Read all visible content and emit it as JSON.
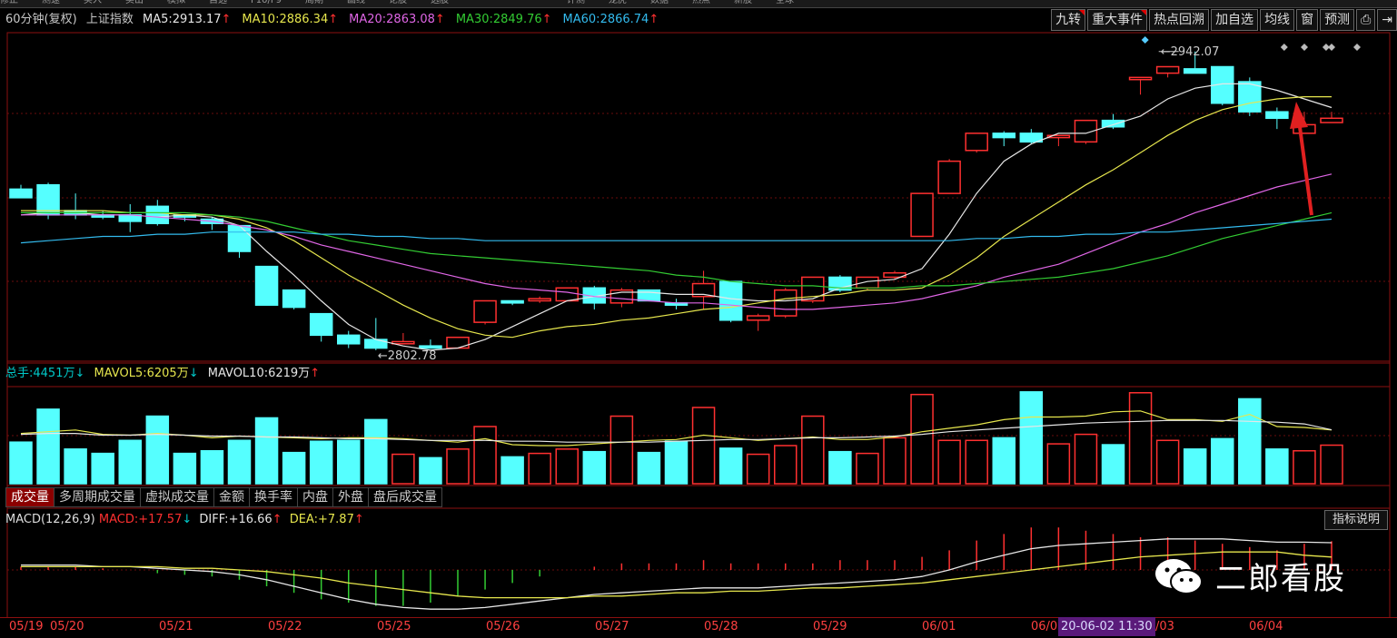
{
  "top_menu": [
    "修正",
    "测速",
    "买入",
    "卖出",
    "模拟",
    "自选",
    "F10/F9",
    "周期",
    "画线",
    "论股",
    "选股",
    "",
    "",
    "",
    "",
    "评测",
    "龙虎",
    "数据",
    "热点",
    "新股",
    "全球",
    "",
    "",
    ""
  ],
  "header": {
    "period": "60分钟(复权)",
    "index_name": "上证指数",
    "ma": [
      {
        "label": "MA5:",
        "value": "2913.17",
        "arrow": "↑",
        "color": "#e6e6e6"
      },
      {
        "label": "MA10:",
        "value": "2886.34",
        "arrow": "↑",
        "color": "#e6e64d"
      },
      {
        "label": "MA20:",
        "value": "2863.08",
        "arrow": "↑",
        "color": "#e066e6"
      },
      {
        "label": "MA30:",
        "value": "2849.76",
        "arrow": "↑",
        "color": "#33cc33"
      },
      {
        "label": "MA60:",
        "value": "2866.74",
        "arrow": "↑",
        "color": "#33bbee"
      }
    ]
  },
  "right_buttons": [
    {
      "label": "九转",
      "flag": true
    },
    {
      "label": "重大事件",
      "flag": true
    },
    {
      "label": "热点回溯",
      "flag": false
    },
    {
      "label": "加自选",
      "flag": false
    },
    {
      "label": "均线",
      "flag": false
    },
    {
      "label": "窗",
      "flag": false
    },
    {
      "label": "预测",
      "flag": false
    },
    {
      "label": "⎙",
      "flag": false
    },
    {
      "label": "⇥",
      "flag": false
    }
  ],
  "price_annotations": {
    "high": "2942.07",
    "low": "2802.78"
  },
  "volume_header": {
    "total_label": "总手:",
    "total_value": "4451万",
    "total_arrow": "↓",
    "mavol5_label": "MAVOL5:",
    "mavol5_value": "6205万",
    "mavol5_arrow": "↓",
    "mavol10_label": "MAVOL10:",
    "mavol10_value": "6219万",
    "mavol10_arrow": "↑"
  },
  "tabs": [
    "成交量",
    "多周期成交量",
    "虚拟成交量",
    "金额",
    "换手率",
    "内盘",
    "外盘",
    "盘后成交量"
  ],
  "macd_header": {
    "name": "MACD(12,26,9)",
    "macd_label": "MACD:",
    "macd_value": "+17.57",
    "macd_arrow": "↓",
    "diff_label": "DIFF:",
    "diff_value": "+16.66",
    "diff_arrow": "↑",
    "dea_label": "DEA:",
    "dea_value": "+7.87",
    "dea_arrow": "↑"
  },
  "macd_help": "指标说明",
  "watermark": "二郎看股",
  "dates": [
    "05/19",
    "05/20",
    "05/21",
    "05/22",
    "05/25",
    "05/26",
    "05/27",
    "05/28",
    "05/29",
    "06/01",
    "06/0",
    "/03",
    "06/04"
  ],
  "cursor_label": "20-06-02 11:30",
  "colors": {
    "up": "#ff3030",
    "down": "#55ffff",
    "ma5": "#e6e6e6",
    "ma10": "#e6e64d",
    "ma20": "#e066e6",
    "ma30": "#33cc33",
    "ma60": "#33bbee"
  },
  "chart_data": {
    "type": "candlestick",
    "interval": "60min",
    "price_range": [
      2800,
      2950
    ],
    "candles": [
      {
        "o": 2878,
        "h": 2880,
        "l": 2874,
        "c": 2874
      },
      {
        "o": 2880,
        "h": 2881,
        "l": 2864,
        "c": 2866
      },
      {
        "o": 2868,
        "h": 2876,
        "l": 2864,
        "c": 2866
      },
      {
        "o": 2866,
        "h": 2868,
        "l": 2864,
        "c": 2865
      },
      {
        "o": 2866,
        "h": 2871,
        "l": 2858,
        "c": 2863
      },
      {
        "o": 2870,
        "h": 2873,
        "l": 2861,
        "c": 2862
      },
      {
        "o": 2866,
        "h": 2866,
        "l": 2863,
        "c": 2865
      },
      {
        "o": 2864,
        "h": 2865,
        "l": 2859,
        "c": 2862
      },
      {
        "o": 2861,
        "h": 2861,
        "l": 2846,
        "c": 2849
      },
      {
        "o": 2842,
        "h": 2842,
        "l": 2824,
        "c": 2824
      },
      {
        "o": 2831,
        "h": 2831,
        "l": 2822,
        "c": 2823
      },
      {
        "o": 2820,
        "h": 2820,
        "l": 2807,
        "c": 2810
      },
      {
        "o": 2810,
        "h": 2812,
        "l": 2804,
        "c": 2806
      },
      {
        "o": 2808,
        "h": 2818,
        "l": 2803,
        "c": 2804
      },
      {
        "o": 2806,
        "h": 2811,
        "l": 2806,
        "c": 2807
      },
      {
        "o": 2805,
        "h": 2808,
        "l": 2804,
        "c": 2804
      },
      {
        "o": 2804,
        "h": 2809,
        "l": 2804,
        "c": 2809
      },
      {
        "o": 2816,
        "h": 2826,
        "l": 2815,
        "c": 2826
      },
      {
        "o": 2826,
        "h": 2826,
        "l": 2824,
        "c": 2825
      },
      {
        "o": 2826,
        "h": 2828,
        "l": 2825,
        "c": 2827
      },
      {
        "o": 2826,
        "h": 2832,
        "l": 2826,
        "c": 2832
      },
      {
        "o": 2832,
        "h": 2833,
        "l": 2822,
        "c": 2825
      },
      {
        "o": 2825,
        "h": 2832,
        "l": 2823,
        "c": 2831
      },
      {
        "o": 2831,
        "h": 2831,
        "l": 2826,
        "c": 2826
      },
      {
        "o": 2825,
        "h": 2827,
        "l": 2822,
        "c": 2824
      },
      {
        "o": 2828,
        "h": 2840,
        "l": 2822,
        "c": 2834
      },
      {
        "o": 2835,
        "h": 2835,
        "l": 2816,
        "c": 2817
      },
      {
        "o": 2817,
        "h": 2820,
        "l": 2812,
        "c": 2819
      },
      {
        "o": 2819,
        "h": 2832,
        "l": 2818,
        "c": 2831
      },
      {
        "o": 2826,
        "h": 2837,
        "l": 2825,
        "c": 2837
      },
      {
        "o": 2837,
        "h": 2838,
        "l": 2830,
        "c": 2831
      },
      {
        "o": 2832,
        "h": 2837,
        "l": 2831,
        "c": 2837
      },
      {
        "o": 2837,
        "h": 2840,
        "l": 2836,
        "c": 2839
      },
      {
        "o": 2856,
        "h": 2876,
        "l": 2856,
        "c": 2876
      },
      {
        "o": 2876,
        "h": 2892,
        "l": 2876,
        "c": 2891
      },
      {
        "o": 2896,
        "h": 2904,
        "l": 2895,
        "c": 2904
      },
      {
        "o": 2904,
        "h": 2905,
        "l": 2898,
        "c": 2902
      },
      {
        "o": 2904,
        "h": 2906,
        "l": 2899,
        "c": 2900
      },
      {
        "o": 2902,
        "h": 2903,
        "l": 2898,
        "c": 2903
      },
      {
        "o": 2900,
        "h": 2910,
        "l": 2899,
        "c": 2910
      },
      {
        "o": 2910,
        "h": 2913,
        "l": 2906,
        "c": 2907
      },
      {
        "o": 2929,
        "h": 2930,
        "l": 2922,
        "c": 2930
      },
      {
        "o": 2932,
        "h": 2935,
        "l": 2930,
        "c": 2935
      },
      {
        "o": 2934,
        "h": 2942.07,
        "l": 2932,
        "c": 2932
      },
      {
        "o": 2935,
        "h": 2935,
        "l": 2917,
        "c": 2918
      },
      {
        "o": 2928,
        "h": 2930,
        "l": 2912,
        "c": 2914
      },
      {
        "o": 2914,
        "h": 2916,
        "l": 2906,
        "c": 2911
      },
      {
        "o": 2904,
        "h": 2914,
        "l": 2904,
        "c": 2908
      },
      {
        "o": 2909,
        "h": 2914,
        "l": 2909,
        "c": 2911
      }
    ],
    "ma_lines": {
      "MA5": [
        2866,
        2867,
        2867,
        2866,
        2866,
        2865,
        2866,
        2865,
        2861,
        2849,
        2838,
        2826,
        2815,
        2808,
        2805,
        2803,
        2804,
        2808,
        2814,
        2820,
        2826,
        2828,
        2830,
        2830,
        2829,
        2829,
        2827,
        2826,
        2826,
        2827,
        2832,
        2835,
        2836,
        2841,
        2857,
        2876,
        2891,
        2899,
        2904,
        2904,
        2908,
        2912,
        2920,
        2925,
        2927,
        2927,
        2924,
        2920,
        2916
      ],
      "MA10": [
        2868,
        2868,
        2868,
        2868,
        2867,
        2867,
        2866,
        2866,
        2864,
        2860,
        2854,
        2846,
        2838,
        2831,
        2824,
        2818,
        2813,
        2810,
        2809,
        2812,
        2814,
        2815,
        2817,
        2818,
        2820,
        2822,
        2823,
        2825,
        2827,
        2828,
        2829,
        2831,
        2831,
        2832,
        2838,
        2846,
        2856,
        2864,
        2872,
        2880,
        2887,
        2895,
        2903,
        2910,
        2915,
        2918,
        2920,
        2921,
        2921
      ],
      "MA20": [
        2866,
        2866,
        2866,
        2866,
        2866,
        2865,
        2864,
        2863,
        2861,
        2859,
        2856,
        2852,
        2849,
        2846,
        2843,
        2840,
        2837,
        2834,
        2832,
        2831,
        2830,
        2828,
        2827,
        2826,
        2825,
        2825,
        2824,
        2823,
        2822,
        2822,
        2823,
        2824,
        2825,
        2827,
        2830,
        2833,
        2837,
        2840,
        2843,
        2848,
        2853,
        2858,
        2862,
        2867,
        2871,
        2875,
        2879,
        2882,
        2885
      ],
      "MA30": [
        2867,
        2867,
        2867,
        2867,
        2867,
        2867,
        2867,
        2866,
        2865,
        2863,
        2860,
        2857,
        2854,
        2852,
        2850,
        2848,
        2847,
        2846,
        2845,
        2844,
        2843,
        2842,
        2841,
        2840,
        2838,
        2837,
        2835,
        2834,
        2833,
        2833,
        2832,
        2832,
        2832,
        2833,
        2833,
        2834,
        2835,
        2836,
        2837,
        2839,
        2841,
        2844,
        2847,
        2851,
        2855,
        2858,
        2861,
        2864,
        2867
      ],
      "MA60": [
        2853,
        2854,
        2855,
        2856,
        2856,
        2857,
        2857,
        2858,
        2858,
        2858,
        2858,
        2857,
        2857,
        2856,
        2856,
        2855,
        2855,
        2854,
        2854,
        2854,
        2854,
        2854,
        2854,
        2854,
        2854,
        2854,
        2854,
        2854,
        2854,
        2854,
        2854,
        2854,
        2854,
        2854,
        2854,
        2855,
        2855,
        2856,
        2856,
        2857,
        2857,
        2858,
        2858,
        2859,
        2860,
        2861,
        2862,
        2863,
        2864
      ]
    },
    "volume": {
      "unit": "万",
      "values": [
        4800,
        8600,
        4000,
        3500,
        5000,
        7800,
        3500,
        3800,
        5000,
        7600,
        3600,
        4900,
        5000,
        7400,
        3400,
        3000,
        4000,
        6600,
        3100,
        3500,
        4000,
        3700,
        7800,
        3600,
        4900,
        8800,
        4100,
        3400,
        4400,
        7800,
        3700,
        3500,
        5300,
        10300,
        5000,
        5000,
        5300,
        10600,
        4600,
        5700,
        4500,
        10500,
        5000,
        4000,
        5200,
        9800,
        4000,
        3800,
        4451
      ],
      "mavol5": [
        5800,
        6000,
        6200,
        5700,
        5600,
        5800,
        5600,
        5300,
        5500,
        5400,
        5300,
        5200,
        5300,
        5300,
        5200,
        5000,
        4800,
        5200,
        4500,
        4400,
        4400,
        4600,
        4800,
        5000,
        5100,
        5600,
        5300,
        5000,
        5200,
        5400,
        5100,
        5100,
        5400,
        6000,
        6400,
        6800,
        7400,
        7700,
        7700,
        7800,
        8300,
        8400,
        7400,
        7400,
        7200,
        8000,
        6600,
        6500,
        6205
      ],
      "mavol10": [
        5700,
        5800,
        5800,
        5600,
        5600,
        5700,
        5600,
        5500,
        5500,
        5400,
        5400,
        5300,
        5200,
        5200,
        5100,
        5000,
        5000,
        5000,
        4900,
        4900,
        4800,
        4800,
        4800,
        4800,
        4900,
        5000,
        5100,
        5100,
        5200,
        5300,
        5300,
        5400,
        5500,
        5700,
        6000,
        6200,
        6400,
        6600,
        6800,
        7000,
        7100,
        7200,
        7300,
        7300,
        7300,
        7200,
        7100,
        6900,
        6219
      ]
    },
    "macd": {
      "diff": [
        3,
        3,
        3,
        2,
        2,
        1,
        0,
        -1,
        -3,
        -6,
        -10,
        -14,
        -18,
        -21,
        -23,
        -24,
        -24,
        -23,
        -21,
        -19,
        -17,
        -15,
        -14,
        -13,
        -12,
        -11,
        -11,
        -11,
        -10,
        -9,
        -8,
        -7,
        -6,
        -4,
        0,
        5,
        9,
        13,
        15,
        16,
        17,
        18,
        19,
        19,
        19,
        18,
        17,
        17,
        16.66
      ],
      "dea": [
        2,
        2,
        2,
        2,
        2,
        2,
        1,
        1,
        0,
        -1,
        -3,
        -5,
        -8,
        -10,
        -12,
        -14,
        -16,
        -17,
        -17,
        -17,
        -17,
        -16,
        -16,
        -15,
        -14,
        -14,
        -13,
        -13,
        -12,
        -11,
        -11,
        -10,
        -9,
        -8,
        -6,
        -4,
        -2,
        0,
        2,
        4,
        6,
        8,
        9,
        10,
        11,
        11,
        11,
        9,
        7.87
      ],
      "macd": [
        2,
        2,
        2,
        1,
        0,
        -2,
        -3,
        -4,
        -6,
        -10,
        -14,
        -18,
        -20,
        -22,
        -22,
        -20,
        -16,
        -12,
        -8,
        -4,
        0,
        2,
        4,
        4,
        4,
        6,
        4,
        4,
        4,
        4,
        6,
        6,
        6,
        8,
        12,
        18,
        22,
        26,
        26,
        24,
        22,
        20,
        20,
        18,
        16,
        14,
        12,
        16,
        17.57
      ]
    }
  }
}
